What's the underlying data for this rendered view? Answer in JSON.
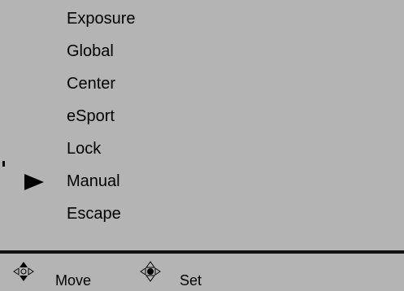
{
  "menu": {
    "items": [
      {
        "label": "Exposure"
      },
      {
        "label": "Global"
      },
      {
        "label": "Center"
      },
      {
        "label": "eSport"
      },
      {
        "label": "Lock"
      },
      {
        "label": "Manual"
      },
      {
        "label": "Escape"
      }
    ],
    "selected_label": "Manual",
    "selector_icon": "play-arrow"
  },
  "footer": {
    "move_label": "Move",
    "set_label": "Set",
    "move_icon": "dpad-up-down",
    "set_icon": "dpad-press"
  },
  "colors": {
    "background": "#b4b4b4",
    "text": "#000000",
    "divider": "#111111"
  }
}
